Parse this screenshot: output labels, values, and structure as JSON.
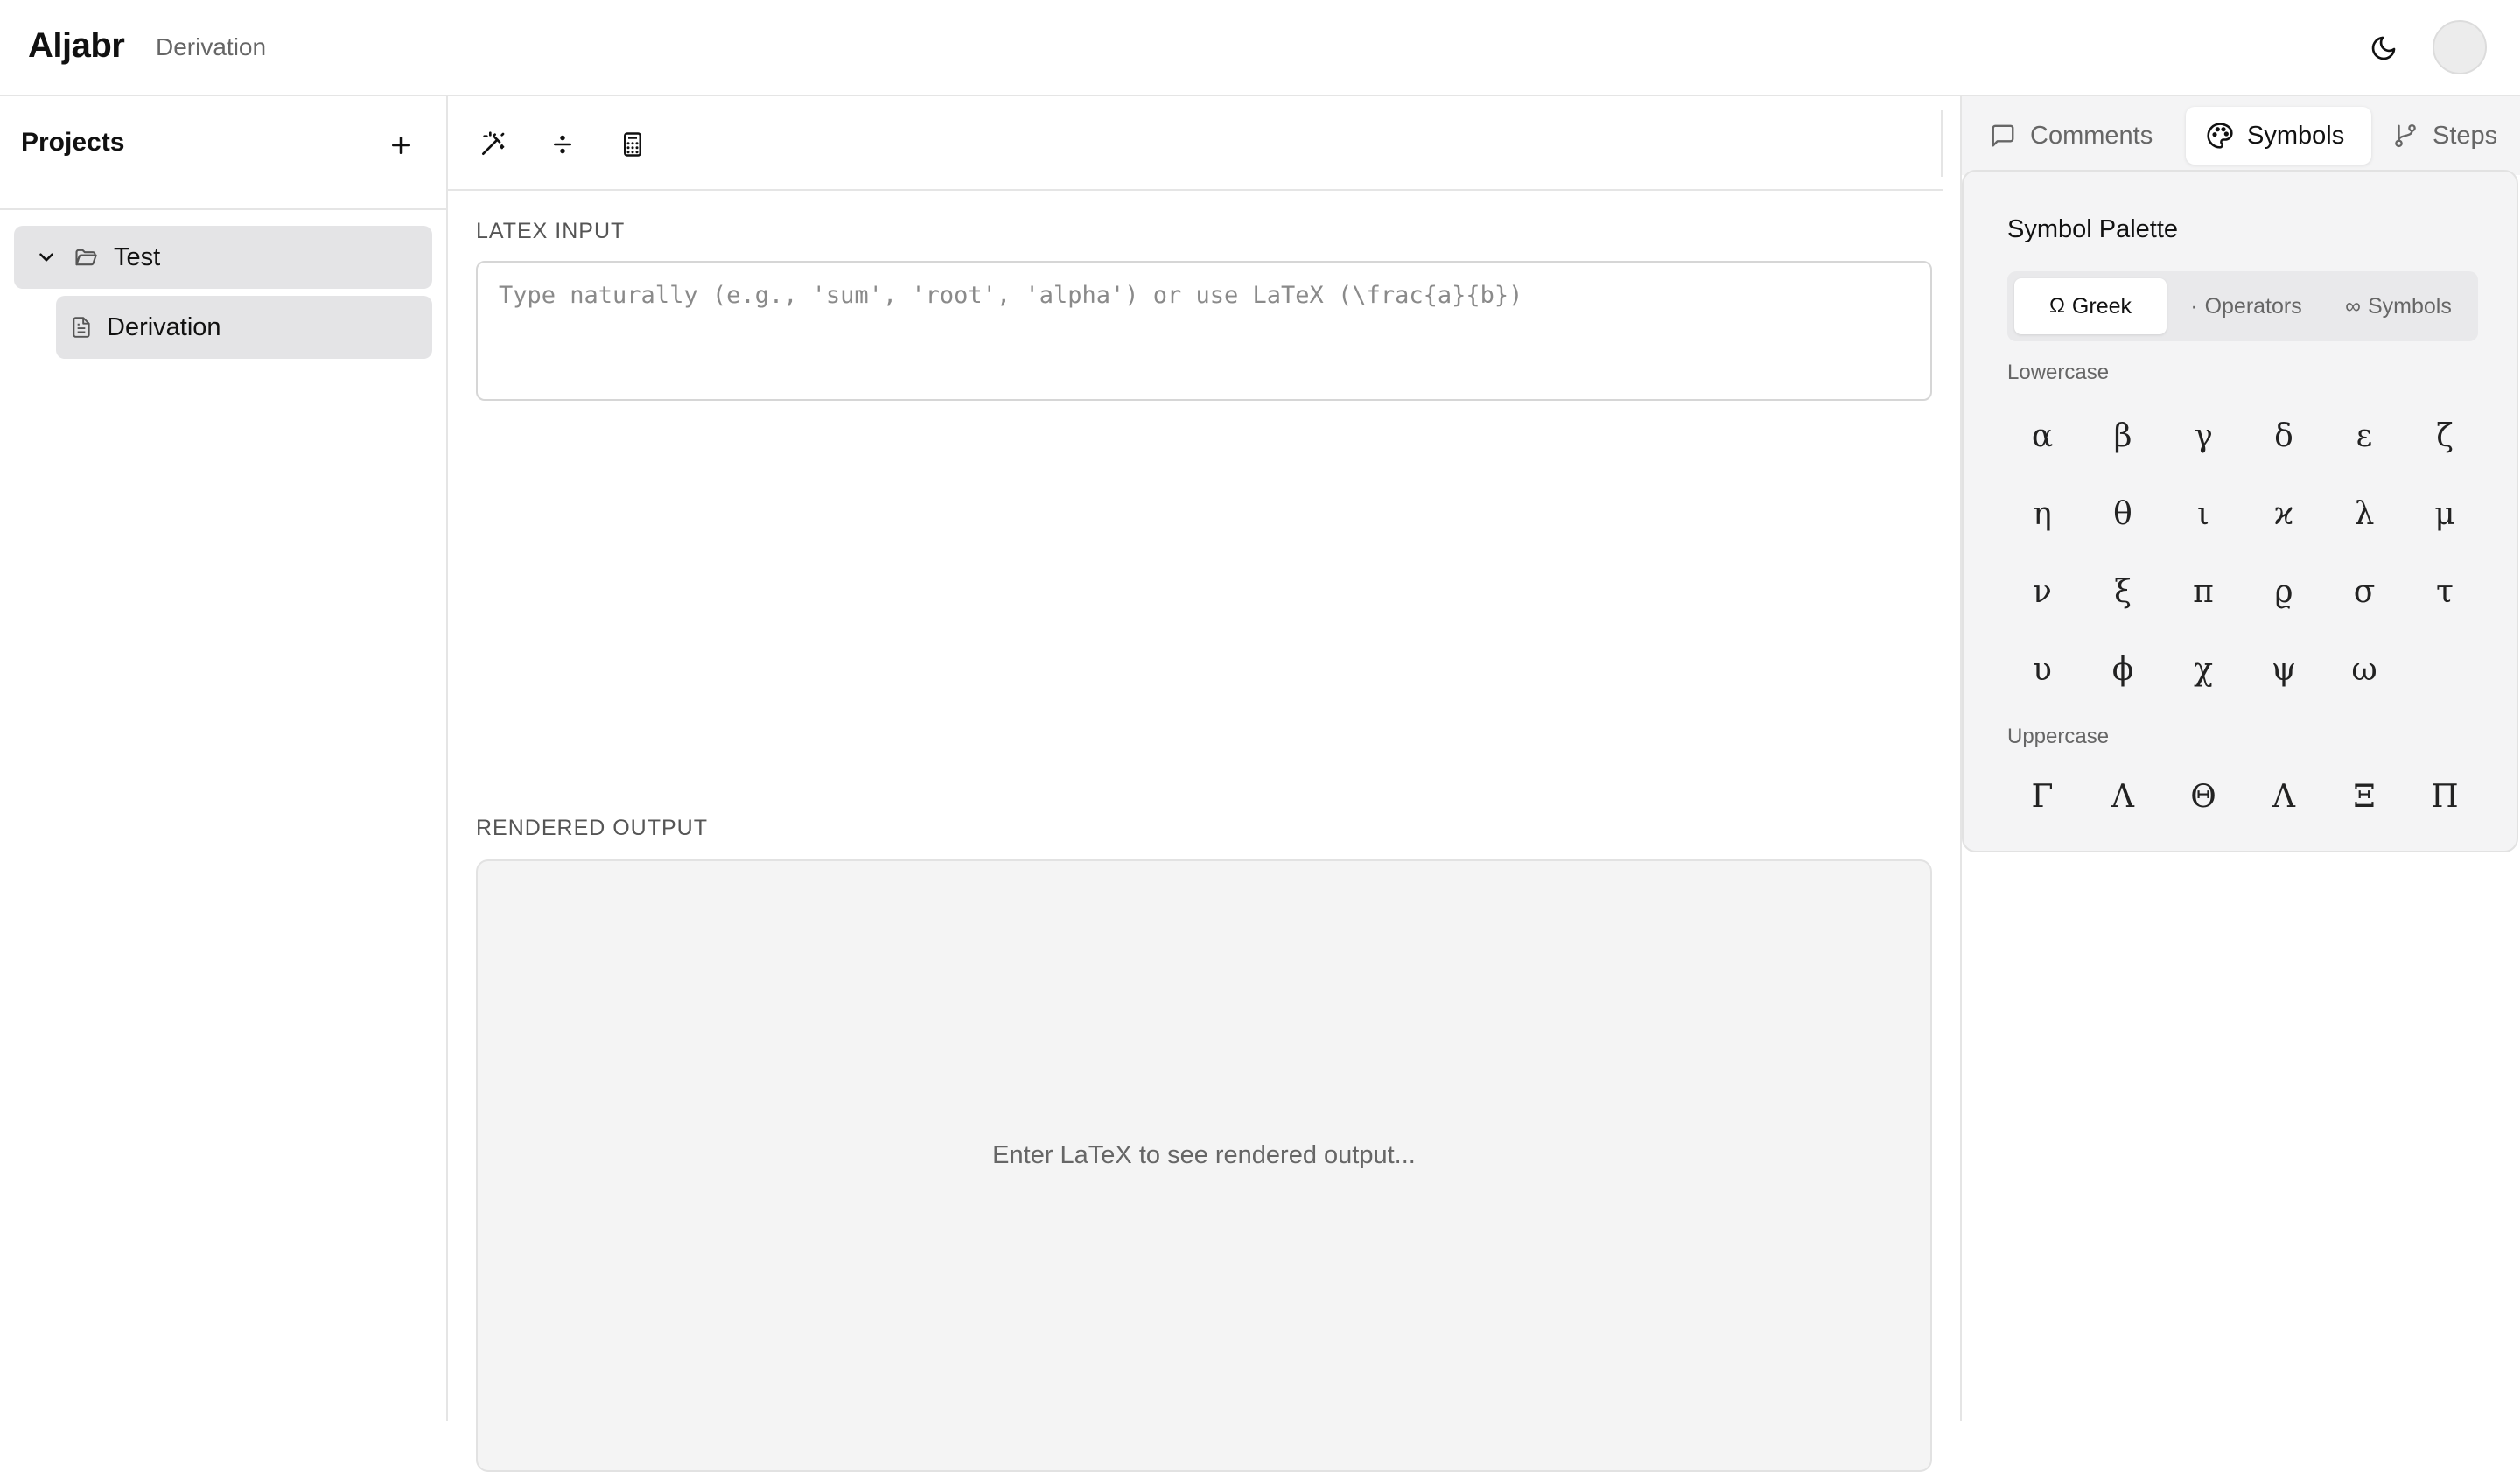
{
  "app": {
    "name": "Aljabr",
    "breadcrumb": "Derivation"
  },
  "header": {
    "theme_toggle_icon": "moon-icon",
    "avatar_icon": "avatar"
  },
  "sidebar": {
    "title": "Projects",
    "add_icon": "plus-icon",
    "folder": {
      "label": "Test",
      "expanded": true,
      "icon": "folder-open-icon"
    },
    "file": {
      "label": "Derivation",
      "icon": "file-text-icon"
    }
  },
  "toolbar": {
    "icons": [
      "magic-wand-icon",
      "divide-icon",
      "calculator-icon"
    ]
  },
  "editor": {
    "input_label": "LATEX INPUT",
    "input_value": "",
    "input_placeholder": "Type naturally (e.g., 'sum', 'root', 'alpha') or use LaTeX (\\frac{a}{b})",
    "output_label": "RENDERED OUTPUT",
    "output_placeholder": "Enter LaTeX to see rendered output..."
  },
  "right_panel": {
    "tabs": [
      {
        "label": "Comments",
        "icon": "message-square-icon",
        "active": false
      },
      {
        "label": "Symbols",
        "icon": "palette-icon",
        "active": true
      },
      {
        "label": "Steps",
        "icon": "git-branch-icon",
        "active": false
      }
    ],
    "palette": {
      "title": "Symbol Palette",
      "categories": [
        {
          "label": "Greek",
          "glyph": "Ω",
          "active": true
        },
        {
          "label": "Operators",
          "glyph": "·",
          "active": false
        },
        {
          "label": "Symbols",
          "glyph": "∞",
          "active": false
        }
      ],
      "groups": [
        {
          "label": "Lowercase",
          "symbols": [
            "α",
            "β",
            "γ",
            "δ",
            "ε",
            "ζ",
            "η",
            "θ",
            "ι",
            "ϰ",
            "λ",
            "μ",
            "ν",
            "ξ",
            "π",
            "ϱ",
            "σ",
            "τ",
            "υ",
            "ϕ",
            "χ",
            "ψ",
            "ω"
          ]
        },
        {
          "label": "Uppercase",
          "symbols": [
            "Γ",
            "Λ",
            "Θ",
            "Λ",
            "Ξ",
            "Π"
          ]
        }
      ]
    }
  },
  "colors": {
    "accent": "#111111",
    "muted": "#666666",
    "border": "#e5e5e5",
    "panel_bg": "#f4f4f5",
    "active_item_bg": "#e4e4e6"
  }
}
